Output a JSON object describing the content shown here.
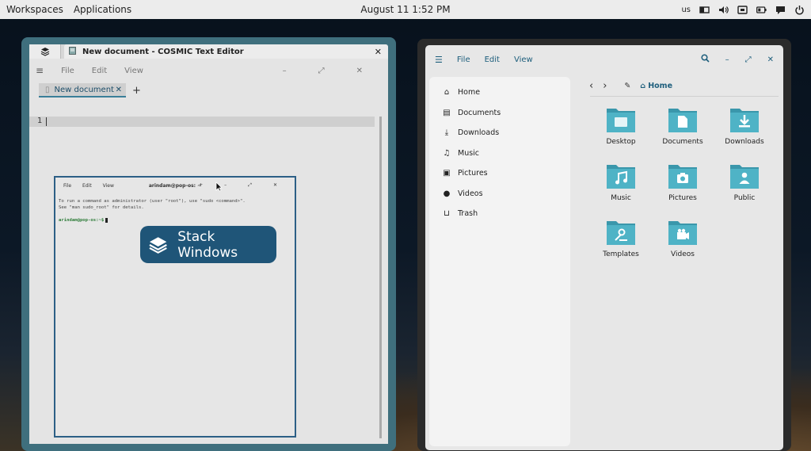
{
  "topbar": {
    "workspaces": "Workspaces",
    "applications": "Applications",
    "clock": "August 11 1:52 PM",
    "keyboard": "us",
    "tray_icons": [
      "workspaces-icon",
      "volume-icon",
      "network-icon",
      "battery-icon",
      "notifications-icon",
      "power-icon"
    ]
  },
  "editor": {
    "window_title": "New document - COSMIC Text Editor",
    "menu": [
      "File",
      "Edit",
      "View"
    ],
    "tab_label": "New document",
    "line_number": "1"
  },
  "terminal": {
    "menu": [
      "File",
      "Edit",
      "View"
    ],
    "title": "arindam@pop-os: ~",
    "lines": [
      "To run a command as administrator (user \"root\"), use \"sudo <command>\".",
      "See \"man sudo_root\" for details."
    ],
    "prompt": "arindam@pop-os:~$"
  },
  "overlay": {
    "label": "Stack Windows"
  },
  "files": {
    "menu": [
      "File",
      "Edit",
      "View"
    ],
    "breadcrumb": "Home",
    "sidebar": [
      {
        "label": "Home",
        "icon": "home-icon"
      },
      {
        "label": "Documents",
        "icon": "document-icon"
      },
      {
        "label": "Downloads",
        "icon": "download-icon"
      },
      {
        "label": "Music",
        "icon": "music-icon"
      },
      {
        "label": "Pictures",
        "icon": "picture-icon"
      },
      {
        "label": "Videos",
        "icon": "video-icon"
      },
      {
        "label": "Trash",
        "icon": "trash-icon"
      }
    ],
    "folders": [
      {
        "label": "Desktop",
        "icon": "desktop"
      },
      {
        "label": "Documents",
        "icon": "documents"
      },
      {
        "label": "Downloads",
        "icon": "downloads"
      },
      {
        "label": "Music",
        "icon": "music"
      },
      {
        "label": "Pictures",
        "icon": "pictures"
      },
      {
        "label": "Public",
        "icon": "public"
      },
      {
        "label": "Templates",
        "icon": "templates"
      },
      {
        "label": "Videos",
        "icon": "videos"
      }
    ]
  },
  "colors": {
    "accent": "#1f5578",
    "folder": "#4fb3c6",
    "folder_dark": "#3a97ab",
    "editor_border": "#3f6f7d"
  }
}
